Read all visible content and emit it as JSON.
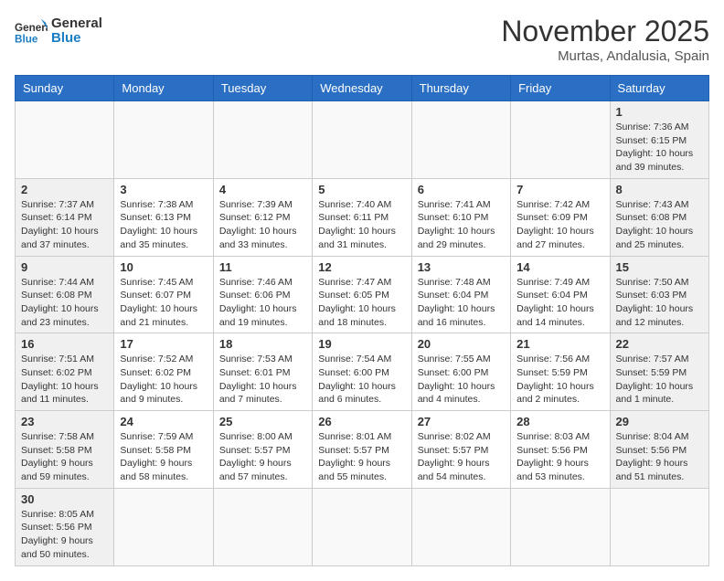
{
  "header": {
    "logo_general": "General",
    "logo_blue": "Blue",
    "month_title": "November 2025",
    "subtitle": "Murtas, Andalusia, Spain"
  },
  "weekdays": [
    "Sunday",
    "Monday",
    "Tuesday",
    "Wednesday",
    "Thursday",
    "Friday",
    "Saturday"
  ],
  "weeks": [
    [
      {
        "day": "",
        "info": ""
      },
      {
        "day": "",
        "info": ""
      },
      {
        "day": "",
        "info": ""
      },
      {
        "day": "",
        "info": ""
      },
      {
        "day": "",
        "info": ""
      },
      {
        "day": "",
        "info": ""
      },
      {
        "day": "1",
        "info": "Sunrise: 7:36 AM\nSunset: 6:15 PM\nDaylight: 10 hours and 39 minutes."
      }
    ],
    [
      {
        "day": "2",
        "info": "Sunrise: 7:37 AM\nSunset: 6:14 PM\nDaylight: 10 hours and 37 minutes."
      },
      {
        "day": "3",
        "info": "Sunrise: 7:38 AM\nSunset: 6:13 PM\nDaylight: 10 hours and 35 minutes."
      },
      {
        "day": "4",
        "info": "Sunrise: 7:39 AM\nSunset: 6:12 PM\nDaylight: 10 hours and 33 minutes."
      },
      {
        "day": "5",
        "info": "Sunrise: 7:40 AM\nSunset: 6:11 PM\nDaylight: 10 hours and 31 minutes."
      },
      {
        "day": "6",
        "info": "Sunrise: 7:41 AM\nSunset: 6:10 PM\nDaylight: 10 hours and 29 minutes."
      },
      {
        "day": "7",
        "info": "Sunrise: 7:42 AM\nSunset: 6:09 PM\nDaylight: 10 hours and 27 minutes."
      },
      {
        "day": "8",
        "info": "Sunrise: 7:43 AM\nSunset: 6:08 PM\nDaylight: 10 hours and 25 minutes."
      }
    ],
    [
      {
        "day": "9",
        "info": "Sunrise: 7:44 AM\nSunset: 6:08 PM\nDaylight: 10 hours and 23 minutes."
      },
      {
        "day": "10",
        "info": "Sunrise: 7:45 AM\nSunset: 6:07 PM\nDaylight: 10 hours and 21 minutes."
      },
      {
        "day": "11",
        "info": "Sunrise: 7:46 AM\nSunset: 6:06 PM\nDaylight: 10 hours and 19 minutes."
      },
      {
        "day": "12",
        "info": "Sunrise: 7:47 AM\nSunset: 6:05 PM\nDaylight: 10 hours and 18 minutes."
      },
      {
        "day": "13",
        "info": "Sunrise: 7:48 AM\nSunset: 6:04 PM\nDaylight: 10 hours and 16 minutes."
      },
      {
        "day": "14",
        "info": "Sunrise: 7:49 AM\nSunset: 6:04 PM\nDaylight: 10 hours and 14 minutes."
      },
      {
        "day": "15",
        "info": "Sunrise: 7:50 AM\nSunset: 6:03 PM\nDaylight: 10 hours and 12 minutes."
      }
    ],
    [
      {
        "day": "16",
        "info": "Sunrise: 7:51 AM\nSunset: 6:02 PM\nDaylight: 10 hours and 11 minutes."
      },
      {
        "day": "17",
        "info": "Sunrise: 7:52 AM\nSunset: 6:02 PM\nDaylight: 10 hours and 9 minutes."
      },
      {
        "day": "18",
        "info": "Sunrise: 7:53 AM\nSunset: 6:01 PM\nDaylight: 10 hours and 7 minutes."
      },
      {
        "day": "19",
        "info": "Sunrise: 7:54 AM\nSunset: 6:00 PM\nDaylight: 10 hours and 6 minutes."
      },
      {
        "day": "20",
        "info": "Sunrise: 7:55 AM\nSunset: 6:00 PM\nDaylight: 10 hours and 4 minutes."
      },
      {
        "day": "21",
        "info": "Sunrise: 7:56 AM\nSunset: 5:59 PM\nDaylight: 10 hours and 2 minutes."
      },
      {
        "day": "22",
        "info": "Sunrise: 7:57 AM\nSunset: 5:59 PM\nDaylight: 10 hours and 1 minute."
      }
    ],
    [
      {
        "day": "23",
        "info": "Sunrise: 7:58 AM\nSunset: 5:58 PM\nDaylight: 9 hours and 59 minutes."
      },
      {
        "day": "24",
        "info": "Sunrise: 7:59 AM\nSunset: 5:58 PM\nDaylight: 9 hours and 58 minutes."
      },
      {
        "day": "25",
        "info": "Sunrise: 8:00 AM\nSunset: 5:57 PM\nDaylight: 9 hours and 57 minutes."
      },
      {
        "day": "26",
        "info": "Sunrise: 8:01 AM\nSunset: 5:57 PM\nDaylight: 9 hours and 55 minutes."
      },
      {
        "day": "27",
        "info": "Sunrise: 8:02 AM\nSunset: 5:57 PM\nDaylight: 9 hours and 54 minutes."
      },
      {
        "day": "28",
        "info": "Sunrise: 8:03 AM\nSunset: 5:56 PM\nDaylight: 9 hours and 53 minutes."
      },
      {
        "day": "29",
        "info": "Sunrise: 8:04 AM\nSunset: 5:56 PM\nDaylight: 9 hours and 51 minutes."
      }
    ],
    [
      {
        "day": "30",
        "info": "Sunrise: 8:05 AM\nSunset: 5:56 PM\nDaylight: 9 hours and 50 minutes."
      },
      {
        "day": "",
        "info": ""
      },
      {
        "day": "",
        "info": ""
      },
      {
        "day": "",
        "info": ""
      },
      {
        "day": "",
        "info": ""
      },
      {
        "day": "",
        "info": ""
      },
      {
        "day": "",
        "info": ""
      }
    ]
  ]
}
